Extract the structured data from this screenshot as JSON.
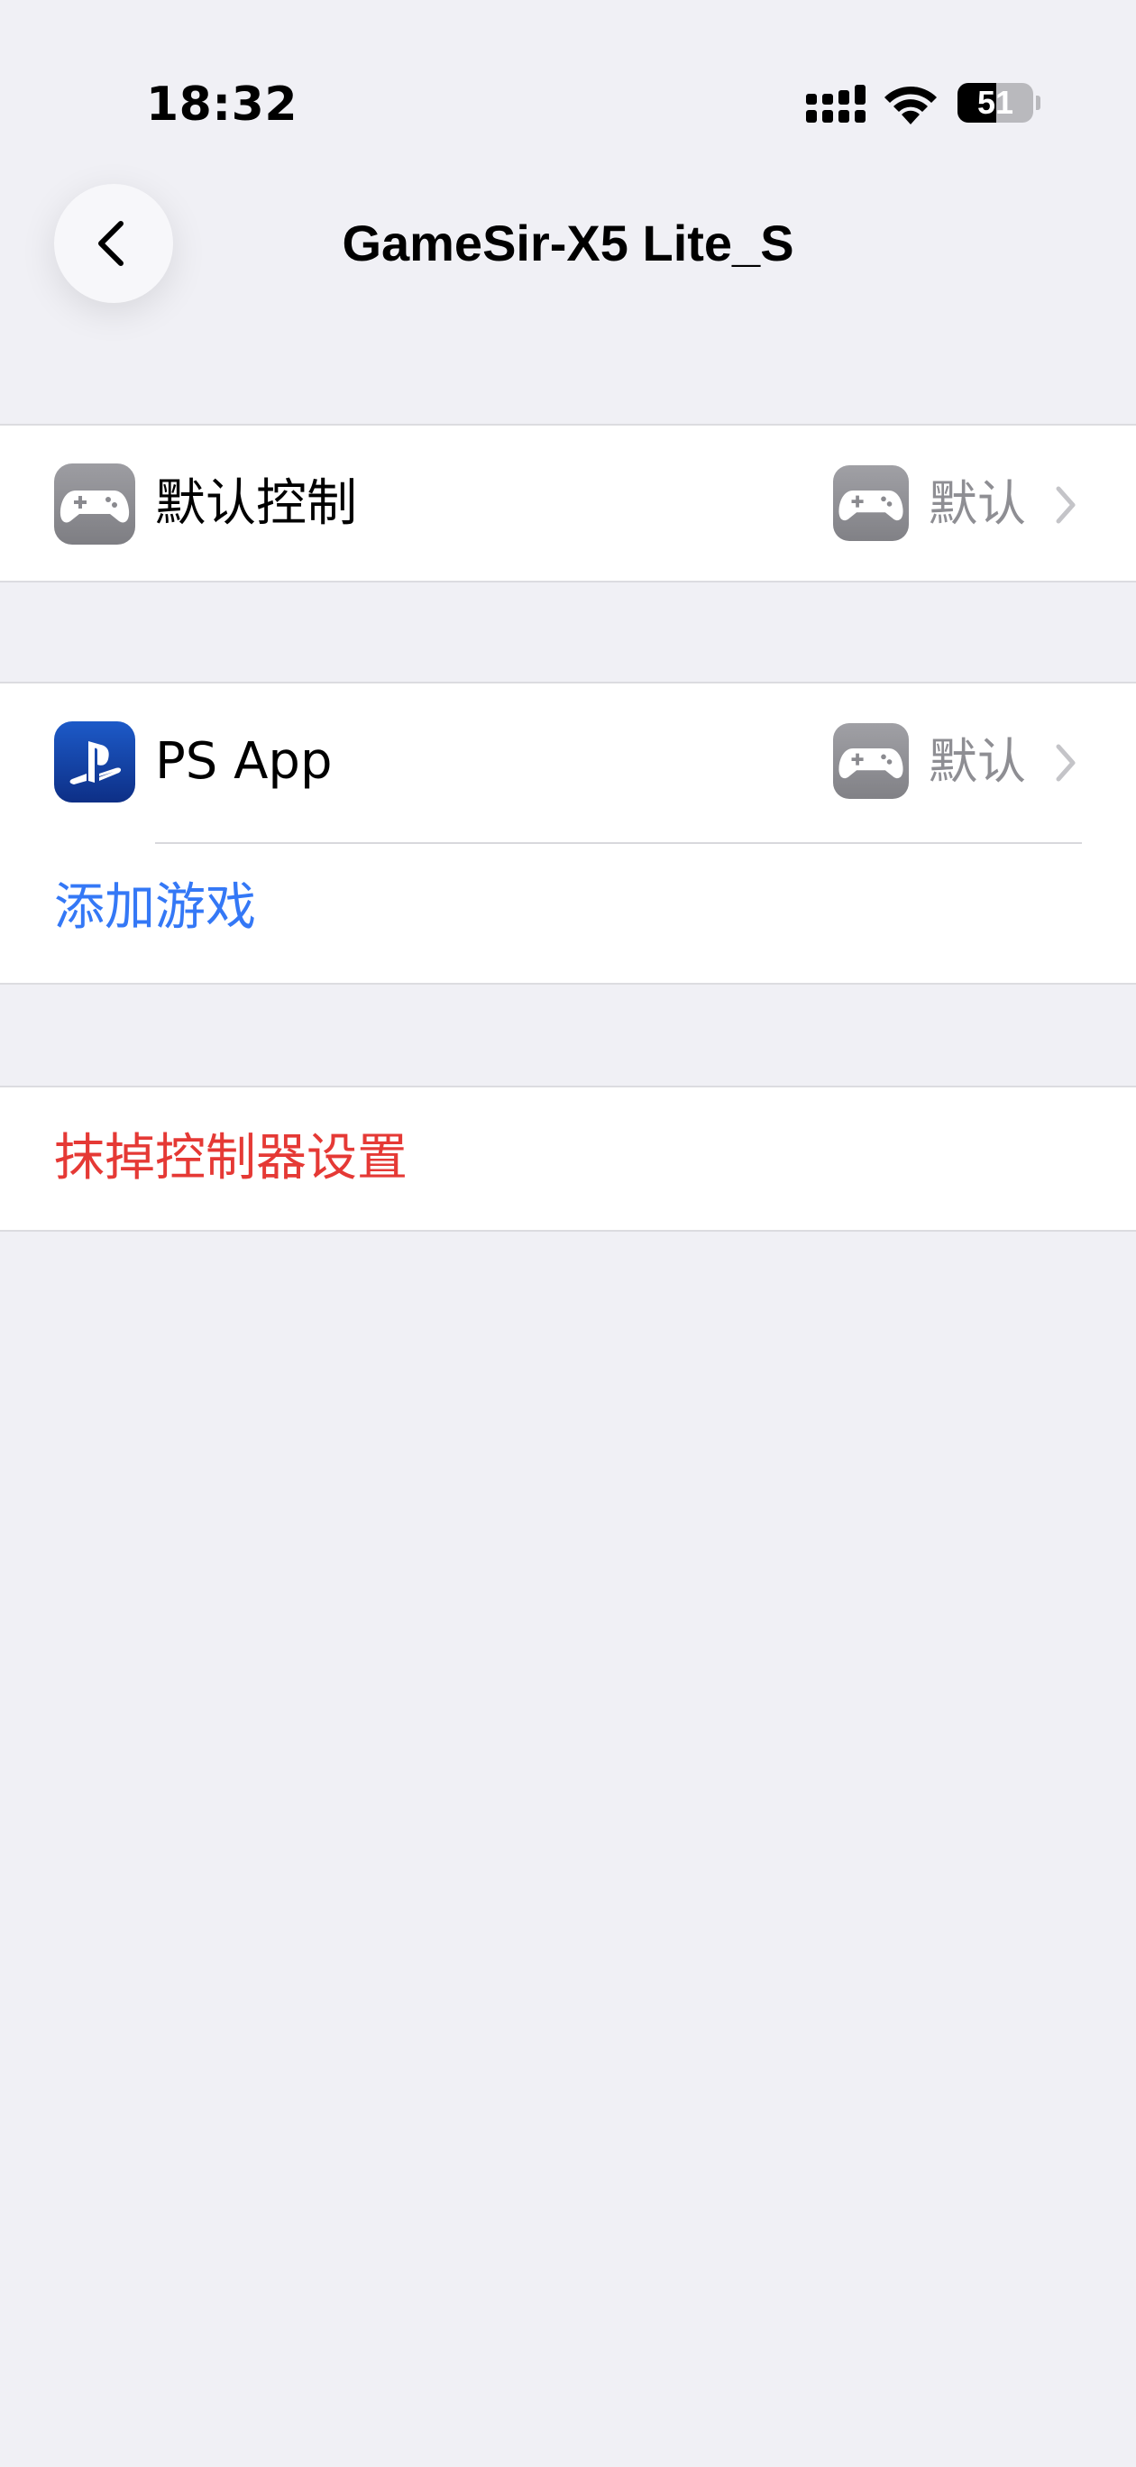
{
  "status_bar": {
    "time": "18:32",
    "battery_level": "51",
    "battery_fraction": 0.51,
    "icons": [
      "signal-icon",
      "wifi-icon",
      "battery-icon"
    ]
  },
  "nav": {
    "back_icon": "chevron-left-icon",
    "title": "GameSir-X5 Lite_S"
  },
  "default_section": {
    "label": "默认控制",
    "icon": "gamepad-icon",
    "value_icon": "gamepad-icon",
    "value": "默认"
  },
  "games_section": {
    "items": [
      {
        "label": "PS App",
        "icon": "playstation-icon",
        "value_icon": "gamepad-icon",
        "value": "默认"
      }
    ],
    "add_label": "添加游戏"
  },
  "reset_section": {
    "label": "抹掉控制器设置"
  },
  "colors": {
    "background": "#f0f0f5",
    "link_blue": "#3478f6",
    "destructive_red": "#e53935",
    "secondary_gray": "#8e8e93"
  }
}
